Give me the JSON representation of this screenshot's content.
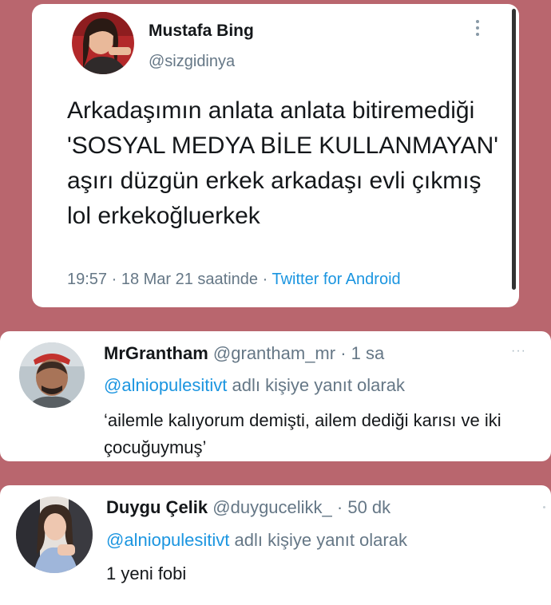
{
  "tweet": {
    "name": "Mustafa Bing",
    "handle": "@sizgidinya",
    "text": "Arkadaşımın anlata anlata bitiremediği 'SOSYAL MEDYA BİLE KULLANMAYAN' aşırı düzgün erkek arkadaşı evli çıkmış lol erkekoğluerkek",
    "time": "19:57 · 18 Mar 21 saatinde · ",
    "source": "Twitter for Android"
  },
  "replies": [
    {
      "name": "MrGrantham",
      "handle": "@grantham_mr",
      "age": " · 1 sa",
      "reply_to_handle": "@alniopulesitivt",
      "reply_to_suffix": " adlı kişiye yanıt olarak",
      "text": "‘ailemle kalıyorum demişti, ailem dediği karısı ve iki çocuğuymuş’",
      "more": "···"
    },
    {
      "name": "Duygu Çelik",
      "handle": "@duygucelikk_",
      "age": " · 50 dk",
      "reply_to_handle": "@alniopulesitivt",
      "reply_to_suffix": " adlı kişiye yanıt olarak",
      "text": "1 yeni fobi"
    }
  ],
  "colors": {
    "background": "#b9666e",
    "link": "#1b95e0",
    "muted": "#657786"
  }
}
